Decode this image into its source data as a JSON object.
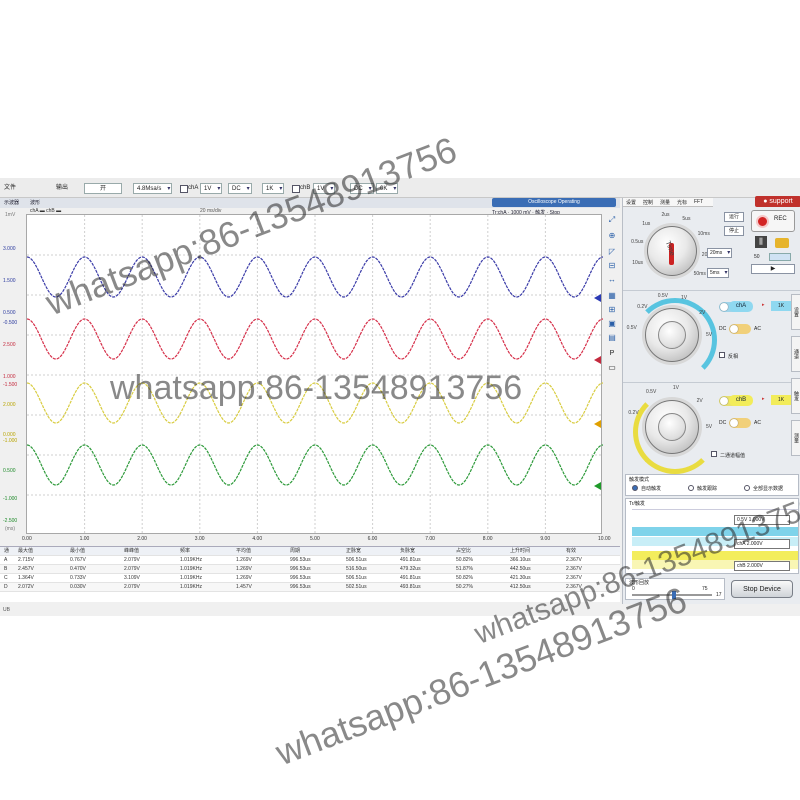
{
  "toolbar": {
    "item1": "文件",
    "item2": "输出",
    "item3": "开",
    "sample_sel": "4.8Msa/s",
    "chA_label": "chA",
    "chA_sel": "1V",
    "chA_coupling": "DC",
    "chB_label": "chB",
    "chB_sel": "1V",
    "chB_coupling": "DC",
    "sel_1k": "1K",
    "sel_1v": "1V",
    "sel_dc": "DC",
    "sel_0k": "0K"
  },
  "scope": {
    "tab1": "示波器",
    "tab2": "波形",
    "ch_legend": "chA ▬  chB ▬",
    "time_hint": "20 ms/div",
    "status_title": "Oscilloscope Operating",
    "status_line": "Tr:chA · 1000 mV · 触发 · Stop",
    "unit_left": "1mV",
    "unit_bottom": "(ms)",
    "y_labels": [
      {
        "v": "3.000",
        "c": "#2b3a9e"
      },
      {
        "v": "1.500",
        "c": "#2b3a9e"
      },
      {
        "v": "0.500",
        "c": "#2b3a9e"
      },
      {
        "v": "-0.500",
        "c": "#2b3a9e"
      },
      {
        "v": "2.500",
        "c": "#c42a3e"
      },
      {
        "v": "1.000",
        "c": "#c42a3e"
      },
      {
        "v": "-1.500",
        "c": "#c42a3e"
      },
      {
        "v": "2.000",
        "c": "#b8a400"
      },
      {
        "v": "0.000",
        "c": "#b8a400"
      },
      {
        "v": "-1.000",
        "c": "#b8a400"
      },
      {
        "v": "0.500",
        "c": "#1f8a2a"
      },
      {
        "v": "-1.000",
        "c": "#1f8a2a"
      },
      {
        "v": "-2.500",
        "c": "#1f8a2a"
      }
    ],
    "x_ticks": [
      "0.00",
      "1.00",
      "2.00",
      "3.00",
      "4.00",
      "5.00",
      "6.00",
      "7.00",
      "8.00",
      "9.00",
      "10.00"
    ],
    "markers": [
      {
        "label": "A",
        "color": "#2b3ab5"
      },
      {
        "label": "B",
        "color": "#c42a3e"
      },
      {
        "label": "C",
        "color": "#e0a000"
      },
      {
        "label": "D",
        "color": "#1f9a2a"
      }
    ]
  },
  "traces": [
    {
      "name": "A",
      "color": "#3b3ca8",
      "cycles": 10,
      "phase": 0.0
    },
    {
      "name": "B",
      "color": "#d6304a",
      "cycles": 10,
      "phase": 0.0
    },
    {
      "name": "C",
      "color": "#d8cc40",
      "cycles": 10,
      "phase": 0.0
    },
    {
      "name": "D",
      "color": "#2d9a3a",
      "cycles": 10,
      "phase": 0.0
    }
  ],
  "table": {
    "headers": [
      "通",
      "最大值",
      "最小值",
      "峰峰值",
      "频率",
      "平均值",
      "周期",
      "正脉宽",
      "负脉宽",
      "占空比",
      "上升时间",
      "有效"
    ],
    "rows": [
      [
        "A",
        "2.715V",
        "0.767V",
        "2.079V",
        "1.019KHz",
        "1.269V",
        "996.53us",
        "506.51us",
        "491.81us",
        "50.82%",
        "366.10us",
        "2.367V"
      ],
      [
        "B",
        "2.457V",
        "0.470V",
        "2.079V",
        "1.019KHz",
        "1.269V",
        "996.53us",
        "516.50us",
        "479.32us",
        "51.87%",
        "442.50us",
        "2.367V"
      ],
      [
        "C",
        "1.364V",
        "0.733V",
        "3.109V",
        "1.019KHz",
        "1.269V",
        "996.53us",
        "506.51us",
        "491.81us",
        "50.82%",
        "421.30us",
        "2.367V"
      ],
      [
        "D",
        "2.072V",
        "0.030V",
        "2.079V",
        "1.019KHz",
        "1.457V",
        "996.53us",
        "502.51us",
        "493.81us",
        "50.27%",
        "412.50us",
        "2.367V"
      ]
    ]
  },
  "footer": {
    "text": "UB"
  },
  "panel": {
    "tabs": [
      "设置",
      "控制",
      "测量",
      "光标",
      "FFT"
    ],
    "support": "support",
    "time_ring": [
      "10us",
      "0.5us",
      "1us",
      "2us",
      "5us",
      "10ms",
      "20ms",
      "50ms"
    ],
    "time_text": "Time",
    "time_sel": "20ms",
    "offset_sel": "5ms",
    "btn_run": "运行",
    "btn_stop": "停止",
    "rec": "REC",
    "num_50": "50",
    "play": "▶",
    "chA_ring": [
      "0.5V",
      "0.2V",
      "0.5V",
      "1V",
      "2V",
      "5V"
    ],
    "chA_badge": "chA",
    "chA_value": "1K",
    "chA_dc": "DC",
    "chA_ac": "AC",
    "chA_check": "反相",
    "chB_ring": [
      "0.2V",
      "0.5V",
      "1V",
      "2V",
      "5V"
    ],
    "chB_badge": "chB",
    "chB_value": "1K",
    "chB_dc": "DC",
    "chB_ac": "AC",
    "chB_check": "二通道幅值",
    "trigger_title": "触发模式",
    "trigger_modes": [
      "自动触发",
      "触发跟踪",
      "全部显示数据"
    ],
    "trigger_section": "Tr/触发",
    "trig_level": "0.5V 1.000V",
    "chA_level": "chA 2.000V",
    "chB_level": "chB 2.000V",
    "slider_title": "波形回放",
    "slider_min": "0",
    "slider_max": "75",
    "slider_max2": "17",
    "stop_device": "Stop Device",
    "side_tabs": [
      "设置",
      "通道",
      "触发",
      "测量"
    ]
  },
  "watermarks": [
    "whatsapp:86-13548913756",
    "whatsapp:86-13548913756",
    "whatsapp:86-13548913756",
    "whatsapp:86-13548913756"
  ]
}
